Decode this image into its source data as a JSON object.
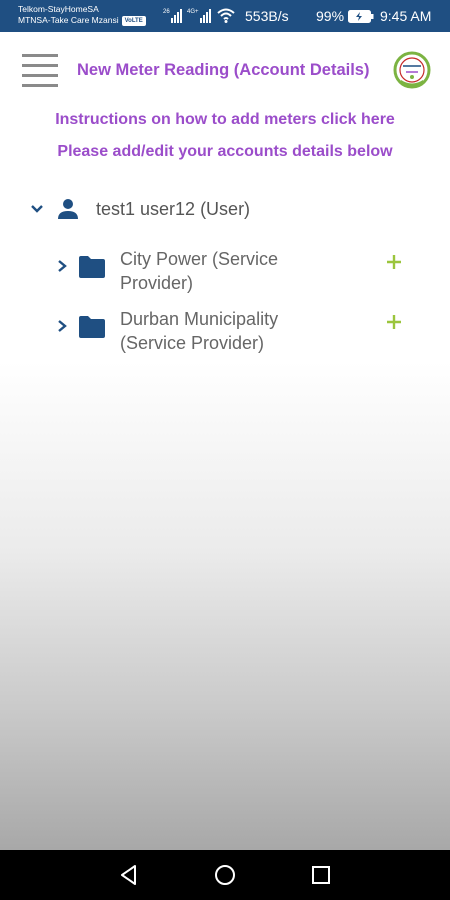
{
  "status_bar": {
    "carrier1": "Telkom-StayHomeSA",
    "carrier2": "MTNSA-Take Care Mzansi",
    "volte": "VoLTE",
    "signal1_label": "26",
    "signal2_label": "4G+",
    "net_speed": "553B/s",
    "battery_percent": "99%",
    "time": "9:45 AM"
  },
  "header": {
    "menu_icon": "hamburger-menu-icon",
    "title": "New Meter Reading (Account Details)",
    "logo_icon": "app-logo"
  },
  "instructions_link": "Instructions on how to add meters click here",
  "subtitle": "Please add/edit your accounts details below",
  "tree": {
    "user": {
      "label": "test1 user12 (User)",
      "expanded": true
    },
    "providers": [
      {
        "label": "City Power (Service Provider)"
      },
      {
        "label": "Durban Municipality (Service Provider)"
      }
    ]
  },
  "colors": {
    "accent_purple": "#9b4dca",
    "icon_blue": "#1f4f82",
    "plus_green": "#9bc53d",
    "status_bar": "#1f4f82"
  },
  "nav": {
    "back_icon": "back-triangle-icon",
    "home_icon": "home-circle-icon",
    "recents_icon": "recents-square-icon"
  }
}
